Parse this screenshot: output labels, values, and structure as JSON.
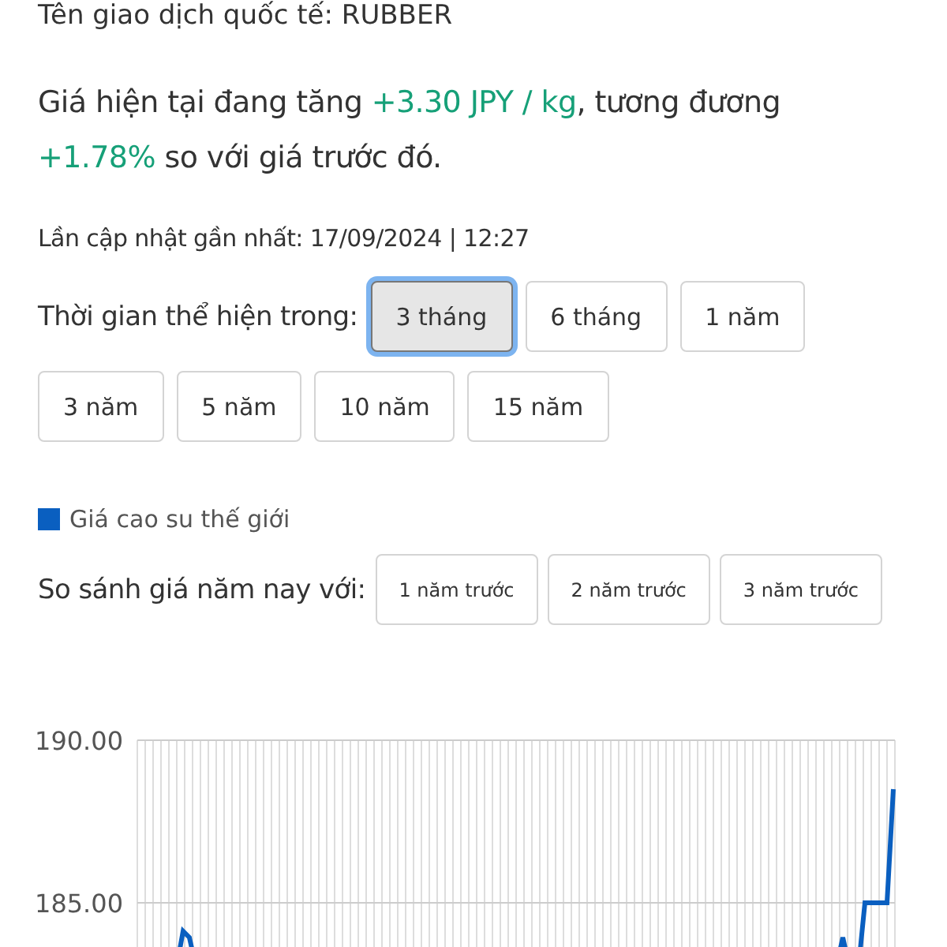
{
  "trading_name": "Tên giao dịch quốc tế: RUBBER",
  "price_change": {
    "segments": [
      {
        "text": "Giá hiện tại đang tăng ",
        "highlight": false
      },
      {
        "text": "+3.30 JPY / kg",
        "highlight": true
      },
      {
        "text": ", tương đương ",
        "highlight": false
      },
      {
        "text": "+1.78%",
        "highlight": true
      },
      {
        "text": " so với giá trước đó.",
        "highlight": false
      }
    ]
  },
  "last_update": "Lần cập nhật gần nhất: 17/09/2024 | 12:27",
  "period": {
    "label": "Thời gian thể hiện trong:",
    "options": [
      {
        "label": "3 tháng",
        "selected": true
      },
      {
        "label": "6 tháng",
        "selected": false
      },
      {
        "label": "1 năm",
        "selected": false
      },
      {
        "label": "3 năm",
        "selected": false
      },
      {
        "label": "5 năm",
        "selected": false
      },
      {
        "label": "10 năm",
        "selected": false
      },
      {
        "label": "15 năm",
        "selected": false
      }
    ]
  },
  "legend": {
    "label": "Giá cao su thế giới",
    "color": "#0a5fc0"
  },
  "compare": {
    "label": "So sánh giá năm nay với:",
    "options": [
      {
        "label": "1 năm trước",
        "selected": false
      },
      {
        "label": "2 năm trước",
        "selected": false
      },
      {
        "label": "3 năm trước",
        "selected": false
      }
    ]
  },
  "chart": {
    "y_axis_labels": [
      "190.00",
      "185.00"
    ]
  }
}
